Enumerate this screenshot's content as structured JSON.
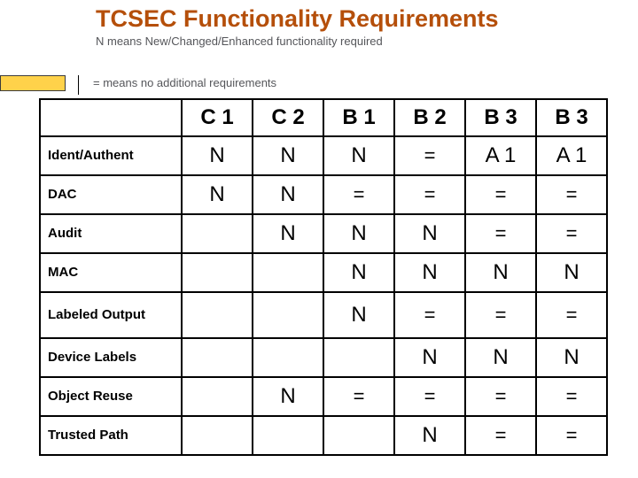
{
  "title": "TCSEC Functionality Requirements",
  "legend_n": "N means New/Changed/Enhanced functionality required",
  "legend_eq": "= means no additional requirements",
  "columns": {
    "c1": "C 1",
    "c2": "C 2",
    "b1": "B 1",
    "b2": "B 2",
    "b3": "B 3",
    "a1": "B 3"
  },
  "chart_data": {
    "type": "table",
    "columns": [
      "C 1",
      "C 2",
      "B 1",
      "B 2",
      "B 3",
      "B 3"
    ],
    "rows": [
      {
        "label": "Ident/Authent",
        "cells": [
          "N",
          "N",
          "N",
          "=",
          "A 1",
          "A 1"
        ]
      },
      {
        "label": "DAC",
        "cells": [
          "N",
          "N",
          "=",
          "=",
          "=",
          "="
        ]
      },
      {
        "label": "Audit",
        "cells": [
          "",
          "N",
          "N",
          "N",
          "=",
          "="
        ]
      },
      {
        "label": "MAC",
        "cells": [
          "",
          "",
          "N",
          "N",
          "N",
          "N"
        ]
      },
      {
        "label": "Labeled Output",
        "cells": [
          "",
          "",
          "N",
          "=",
          "=",
          "="
        ]
      },
      {
        "label": "Device Labels",
        "cells": [
          "",
          "",
          "",
          "N",
          "N",
          "N"
        ]
      },
      {
        "label": "Object Reuse",
        "cells": [
          "",
          "N",
          "=",
          "=",
          "=",
          "="
        ]
      },
      {
        "label": "Trusted Path",
        "cells": [
          "",
          "",
          "",
          "N",
          "=",
          "="
        ]
      }
    ]
  },
  "r0": {
    "label": "Ident/Authent",
    "c0": "N",
    "c1": "N",
    "c2": "N",
    "c3": "=",
    "c4": "A 1",
    "c5": "A 1"
  },
  "r1": {
    "label": "DAC",
    "c0": "N",
    "c1": "N",
    "c2": "=",
    "c3": "=",
    "c4": "=",
    "c5": "="
  },
  "r2": {
    "label": "Audit",
    "c0": "",
    "c1": "N",
    "c2": "N",
    "c3": "N",
    "c4": "=",
    "c5": "="
  },
  "r3": {
    "label": "MAC",
    "c0": "",
    "c1": "",
    "c2": "N",
    "c3": "N",
    "c4": "N",
    "c5": "N"
  },
  "r4": {
    "label": "Labeled Output",
    "c0": "",
    "c1": "",
    "c2": "N",
    "c3": "=",
    "c4": "=",
    "c5": "="
  },
  "r5": {
    "label": "Device Labels",
    "c0": "",
    "c1": "",
    "c2": "",
    "c3": "N",
    "c4": "N",
    "c5": "N"
  },
  "r6": {
    "label": "Object Reuse",
    "c0": "",
    "c1": "N",
    "c2": "=",
    "c3": "=",
    "c4": "=",
    "c5": "="
  },
  "r7": {
    "label": "Trusted Path",
    "c0": "",
    "c1": "",
    "c2": "",
    "c3": "N",
    "c4": "=",
    "c5": "="
  }
}
